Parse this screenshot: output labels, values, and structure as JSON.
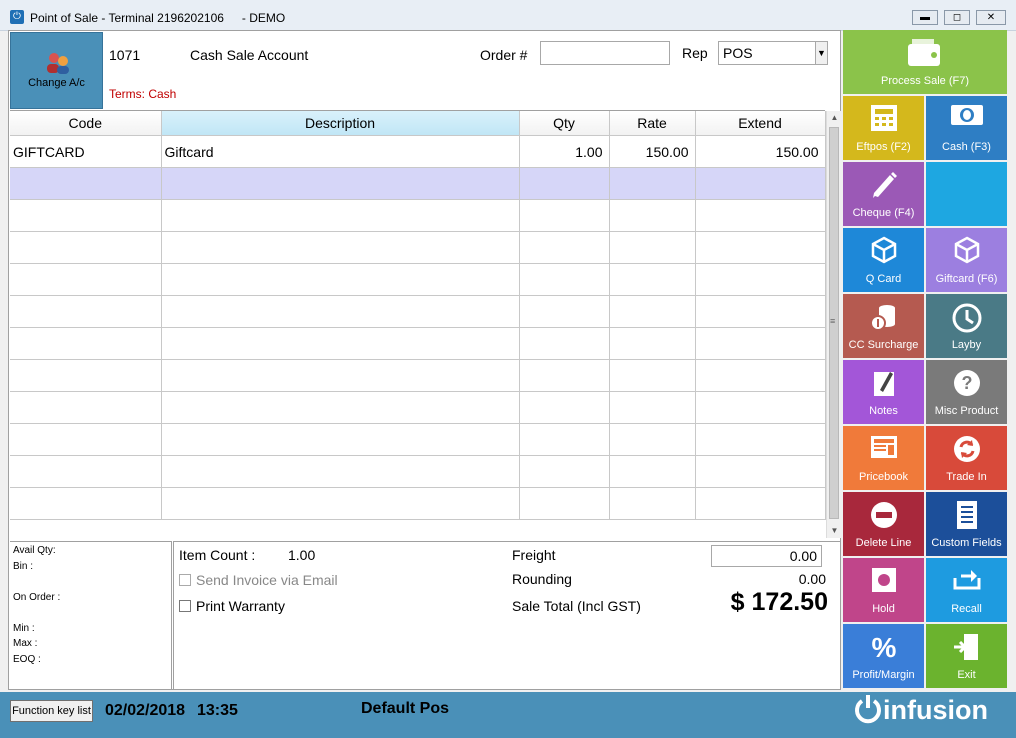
{
  "window": {
    "title": "Point of Sale - Terminal 2196202106",
    "mode": "- DEMO",
    "minimize": "▬",
    "maximize": "◻",
    "close": "✕"
  },
  "account": {
    "change_label": "Change A/c",
    "code": "1071",
    "name": "Cash Sale Account",
    "terms": "Terms: Cash",
    "order_label": "Order #",
    "order_value": "",
    "rep_label": "Rep",
    "rep_value": "POS"
  },
  "grid": {
    "columns": [
      "Code",
      "Description",
      "Qty",
      "Rate",
      "Extend"
    ],
    "rows": [
      {
        "code": "GIFTCARD",
        "description": "Giftcard",
        "qty": "1.00",
        "rate": "150.00",
        "extend": "150.00"
      }
    ]
  },
  "info": {
    "avail_qty": "Avail Qty:",
    "bin": "Bin :",
    "on_order": "On Order :",
    "min": "Min :",
    "max": "Max :",
    "eoq": "EOQ :"
  },
  "totals": {
    "item_count_label": "Item Count :",
    "item_count": "1.00",
    "send_invoice": "Send Invoice via Email",
    "print_warranty": "Print Warranty",
    "freight_label": "Freight",
    "freight": "0.00",
    "rounding_label": "Rounding",
    "rounding": "0.00",
    "sale_total_label": "Sale Total (Incl GST)",
    "sale_total": "$ 172.50"
  },
  "buttons": {
    "process_sale": {
      "label": "Process Sale (F7)",
      "color": "#8bc34a"
    },
    "eftpos": {
      "label": "Eftpos (F2)",
      "color": "#d4b81c"
    },
    "cash": {
      "label": "Cash (F3)",
      "color": "#2e7ec4"
    },
    "cheque": {
      "label": "Cheque (F4)",
      "color": "#9b59b6"
    },
    "blank": {
      "label": "",
      "color": "#1ea7e1"
    },
    "qcard": {
      "label": "Q Card",
      "color": "#1e88d8"
    },
    "giftcard": {
      "label": "Giftcard (F6)",
      "color": "#9c7fe0"
    },
    "cc_surcharge": {
      "label": "CC Surcharge",
      "color": "#b55a50"
    },
    "layby": {
      "label": "Layby",
      "color": "#4a7a86"
    },
    "notes": {
      "label": "Notes",
      "color": "#a356d8"
    },
    "misc_product": {
      "label": "Misc Product",
      "color": "#7a7a7a"
    },
    "pricebook": {
      "label": "Pricebook",
      "color": "#f07a3a"
    },
    "trade_in": {
      "label": "Trade In",
      "color": "#d84a3a"
    },
    "delete_line": {
      "label": "Delete Line",
      "color": "#a8283c"
    },
    "custom_fields": {
      "label": "Custom Fields",
      "color": "#1c4f9a"
    },
    "hold": {
      "label": "Hold",
      "color": "#c0458a"
    },
    "recall": {
      "label": "Recall",
      "color": "#1e9be0"
    },
    "profit_margin": {
      "label": "Profit/Margin",
      "color": "#3a7ed8"
    },
    "exit": {
      "label": "Exit",
      "color": "#6bb32e"
    }
  },
  "status": {
    "function_key_list": "Function key list",
    "date": "02/02/2018",
    "time": "13:35",
    "pos_name": "Default Pos",
    "logo": "infusion"
  }
}
